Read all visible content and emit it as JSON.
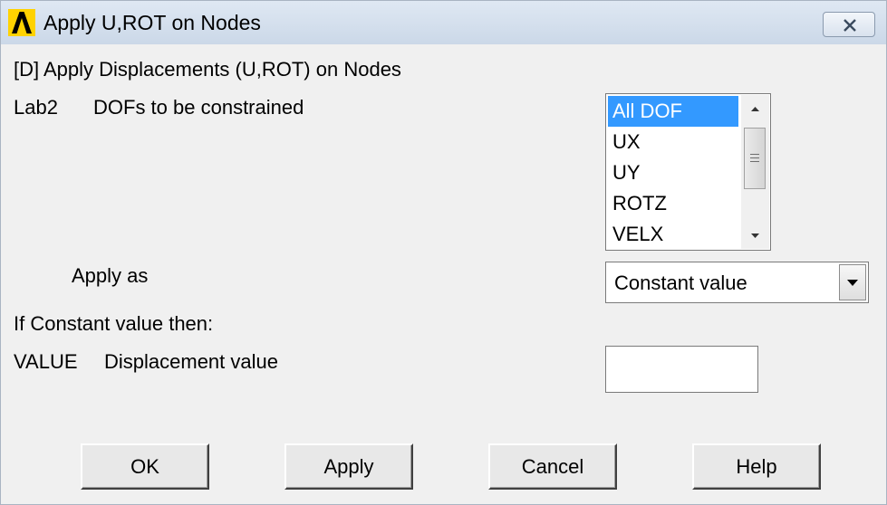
{
  "window": {
    "title": "Apply U,ROT on Nodes",
    "close_symbol": "×"
  },
  "dialog": {
    "heading": "[D]  Apply Displacements (U,ROT) on Nodes",
    "lab2_code": "Lab2",
    "lab2_desc": "DOFs to be constrained",
    "dof_list": {
      "items": [
        "All DOF",
        "UX",
        "UY",
        "ROTZ",
        "VELX"
      ],
      "selected": "All DOF"
    },
    "apply_as_label": "Apply as",
    "apply_as_value": "Constant value",
    "if_constant_label": "If Constant value then:",
    "value_code": "VALUE",
    "value_desc": "Displacement value",
    "value_input": ""
  },
  "buttons": {
    "ok": "OK",
    "apply": "Apply",
    "cancel": "Cancel",
    "help": "Help"
  },
  "icons": {
    "app": "ansys-logo-icon",
    "close": "close-icon",
    "scroll_up": "scroll-up-arrow-icon",
    "scroll_down": "scroll-down-arrow-icon",
    "dropdown": "dropdown-arrow-icon"
  },
  "colors": {
    "selection": "#3399ff",
    "titlebar": "#cbd8e8",
    "dialog_bg": "#f0f0f0"
  }
}
